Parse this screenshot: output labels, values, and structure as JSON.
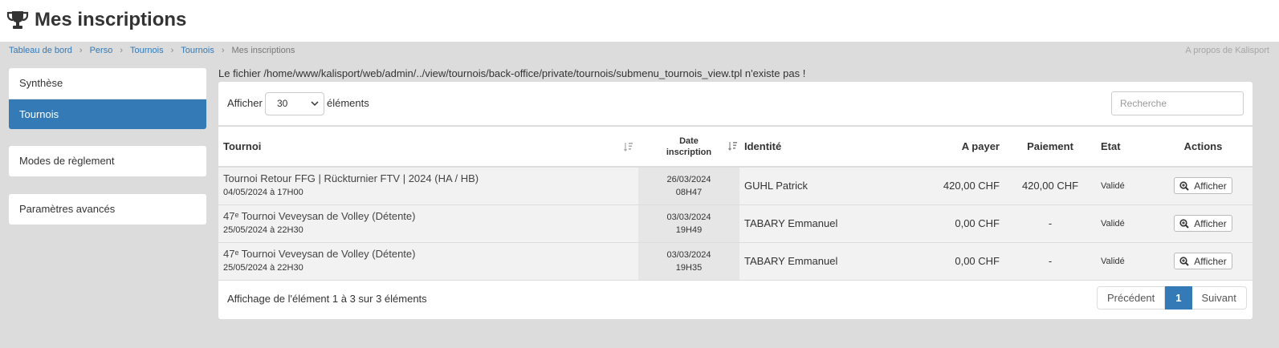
{
  "page": {
    "title": "Mes inscriptions",
    "about": "A propos de Kalisport"
  },
  "breadcrumb": {
    "items": [
      "Tableau de bord",
      "Perso",
      "Tournois",
      "Tournois"
    ],
    "current": "Mes inscriptions"
  },
  "sidebar": {
    "group1": [
      "Synthèse",
      "Tournois"
    ],
    "group2": [
      "Modes de règlement"
    ],
    "group3": [
      "Paramètres avancés"
    ],
    "active": "Tournois"
  },
  "notice": "Le fichier /home/www/kalisport/web/admin/../view/tournois/back-office/private/tournois/submenu_tournois_view.tpl n'existe pas !",
  "table_controls": {
    "show_label": "Afficher",
    "page_size": "30",
    "elements_label": "éléments",
    "search_placeholder": "Recherche"
  },
  "table": {
    "headers": {
      "tournoi": "Tournoi",
      "date_line1": "Date",
      "date_line2": "inscription",
      "identite": "Identité",
      "a_payer": "A payer",
      "paiement": "Paiement",
      "etat": "Etat",
      "actions": "Actions"
    },
    "rows": [
      {
        "tournoi": "Tournoi Retour FFG | Rückturnier FTV | 2024 (HA / HB)",
        "tournoi_date": "04/05/2024 à 17H00",
        "date": "26/03/2024",
        "time": "08H47",
        "identite": "GUHL Patrick",
        "a_payer": "420,00 CHF",
        "paiement": "420,00 CHF",
        "etat": "Validé",
        "action": "Afficher"
      },
      {
        "tournoi": "47ᵉ Tournoi Veveysan de Volley (Détente)",
        "tournoi_date": "25/05/2024 à 22H30",
        "date": "03/03/2024",
        "time": "19H49",
        "identite": "TABARY Emmanuel",
        "a_payer": "0,00 CHF",
        "paiement": "-",
        "etat": "Validé",
        "action": "Afficher"
      },
      {
        "tournoi": "47ᵉ Tournoi Veveysan de Volley (Détente)",
        "tournoi_date": "25/05/2024 à 22H30",
        "date": "03/03/2024",
        "time": "19H35",
        "identite": "TABARY Emmanuel",
        "a_payer": "0,00 CHF",
        "paiement": "-",
        "etat": "Validé",
        "action": "Afficher"
      }
    ]
  },
  "footer": {
    "info": "Affichage de l'élément 1 à 3 sur 3 éléments",
    "prev": "Précédent",
    "page": "1",
    "next": "Suivant"
  },
  "colors": {
    "accent": "#337ab7",
    "background": "#dcdcdc"
  },
  "icons": [
    "trophy-icon",
    "sort-icon",
    "zoom-in-icon",
    "chevron-down-icon"
  ]
}
